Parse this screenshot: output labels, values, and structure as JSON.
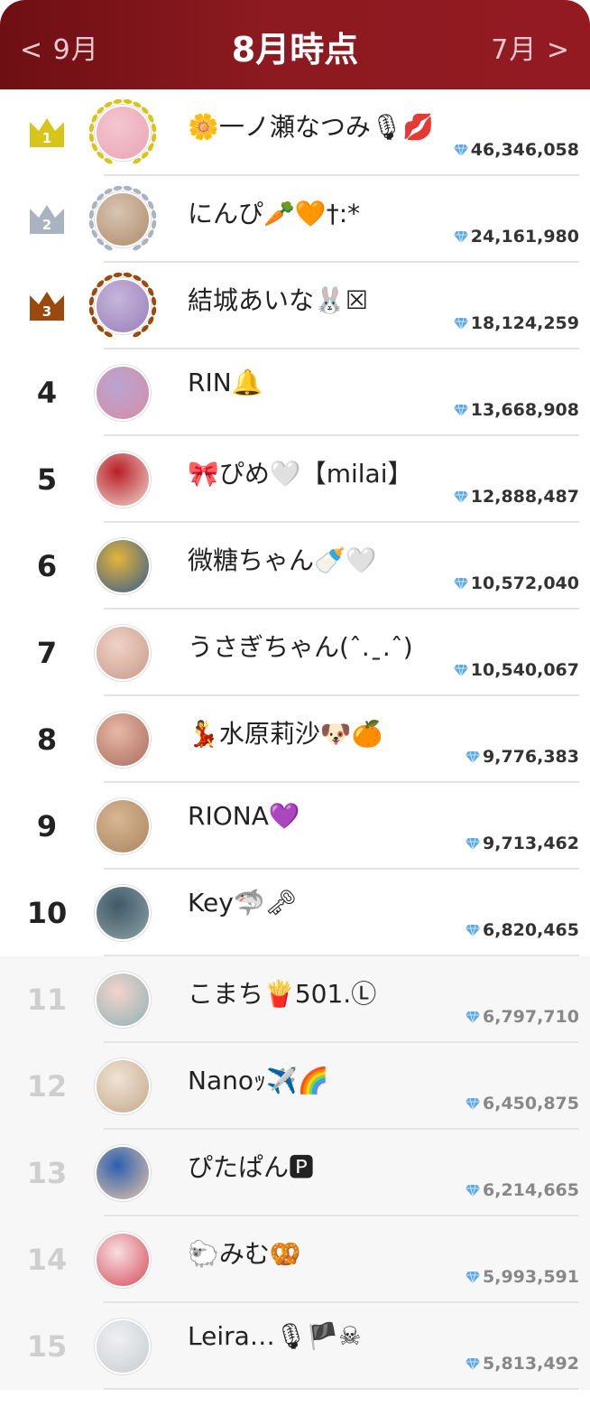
{
  "header": {
    "prev_label": "< 9月",
    "title": "8月時点",
    "next_label": "7月 >"
  },
  "colors": {
    "header_bg": "#8c1a20",
    "gold": "#d7c51a",
    "silver": "#a9b3c2",
    "bronze": "#9a4a0e",
    "gem": "#5aa7e8"
  },
  "ranking": [
    {
      "rank": "1",
      "name": "🌼一ノ瀬なつみ🎙💋",
      "score": "46,346,058",
      "avatar": [
        "#f4c7cf",
        "#e8a4b3"
      ]
    },
    {
      "rank": "2",
      "name": "にんぴ🥕🧡†:*",
      "score": "24,161,980",
      "avatar": [
        "#d8c5b3",
        "#b08a6a"
      ]
    },
    {
      "rank": "3",
      "name": "結城あいな🐰☒",
      "score": "18,124,259",
      "avatar": [
        "#c6b4dd",
        "#9a7fb8"
      ]
    },
    {
      "rank": "4",
      "name": "RIN🔔",
      "score": "13,668,908",
      "avatar": [
        "#b9a5d2",
        "#d68da6"
      ]
    },
    {
      "rank": "5",
      "name": "🎀ぴめ🤍【milai】",
      "score": "12,888,487",
      "avatar": [
        "#b81f27",
        "#f0d6cf"
      ]
    },
    {
      "rank": "6",
      "name": "微糖ちゃん🍼🤍",
      "score": "10,572,040",
      "avatar": [
        "#e3b53a",
        "#355b8f"
      ]
    },
    {
      "rank": "7",
      "name": "うさぎちゃん(ˆ.ˍ.ˆ)",
      "score": "10,540,067",
      "avatar": [
        "#f1d2c8",
        "#c79a88"
      ]
    },
    {
      "rank": "8",
      "name": "💃水原莉沙🐶🍊",
      "score": "9,776,383",
      "avatar": [
        "#e8b8a6",
        "#a86c5c"
      ]
    },
    {
      "rank": "9",
      "name": "RIONA💜",
      "score": "9,713,462",
      "avatar": [
        "#d9b694",
        "#a9855f"
      ]
    },
    {
      "rank": "10",
      "name": "Key🦈🗝",
      "score": "6,820,465",
      "avatar": [
        "#3f5966",
        "#8fa3a8"
      ]
    },
    {
      "rank": "11",
      "name": "こまち🍟501.Ⓛ",
      "score": "6,797,710",
      "avatar": [
        "#f2d4cc",
        "#8eb2b6"
      ]
    },
    {
      "rank": "12",
      "name": "Nanoｯ✈️🌈",
      "score": "6,450,875",
      "avatar": [
        "#efe3d4",
        "#c5a88a"
      ]
    },
    {
      "rank": "13",
      "name": "ぴたぱん🅿",
      "score": "6,214,665",
      "avatar": [
        "#2c5fb0",
        "#e7c6a6"
      ]
    },
    {
      "rank": "14",
      "name": "🐑みむ🥨",
      "score": "5,993,591",
      "avatar": [
        "#f6dfe2",
        "#d64b58"
      ]
    },
    {
      "rank": "15",
      "name": "Leira…🎙🏴☠",
      "score": "5,813,492",
      "avatar": [
        "#eef0f2",
        "#c9ccd0"
      ]
    }
  ]
}
